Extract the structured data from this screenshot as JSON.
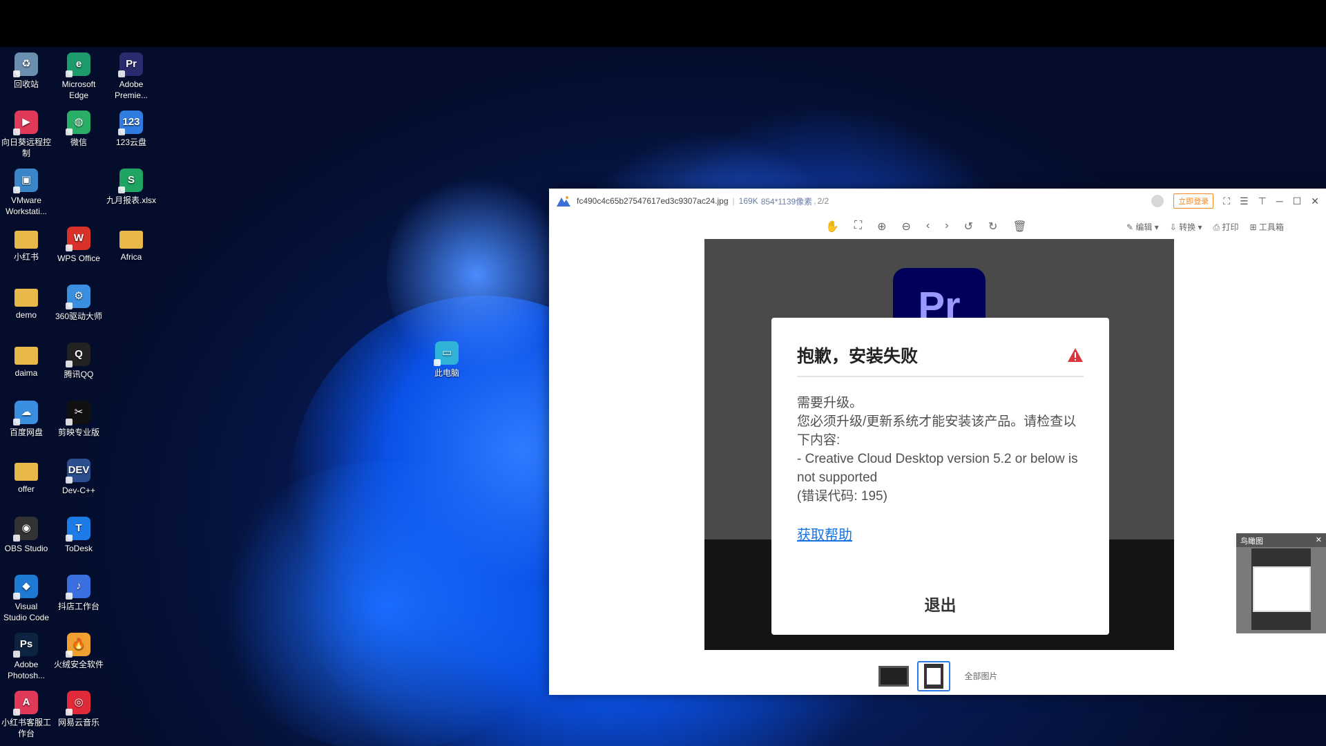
{
  "desktop": {
    "icons": [
      {
        "label": "回收站",
        "glyph": "♻",
        "color": "#6a8fb0"
      },
      {
        "label": "Microsoft\nEdge",
        "glyph": "e",
        "color": "#1d9b6c"
      },
      {
        "label": "Adobe\nPremie...",
        "glyph": "Pr",
        "color": "#2a2a6e"
      },
      {
        "label": "向日葵远程控\n制",
        "glyph": "▶",
        "color": "#e0395a"
      },
      {
        "label": "微信",
        "glyph": "◍",
        "color": "#2aae67"
      },
      {
        "label": "123云盘",
        "glyph": "123",
        "color": "#2f7de1"
      },
      {
        "label": "VMware\nWorkstati...",
        "glyph": "▣",
        "color": "#3a86c8"
      },
      {
        "label": "九月报表.xlsx",
        "glyph": "S",
        "color": "#1fa463"
      },
      {
        "label": "小红书",
        "glyph": "",
        "color": "#e8b84a"
      },
      {
        "label": "WPS Office",
        "glyph": "W",
        "color": "#d9322a"
      },
      {
        "label": "Africa",
        "glyph": "",
        "color": "#e8b84a"
      },
      {
        "label": "demo",
        "glyph": "",
        "color": "#e8b84a"
      },
      {
        "label": "360驱动大师",
        "glyph": "⚙",
        "color": "#3a8fe0"
      },
      {
        "label": "daima",
        "glyph": "",
        "color": "#e8b84a"
      },
      {
        "label": "腾讯QQ",
        "glyph": "Q",
        "color": "#222"
      },
      {
        "label": "百度网盘",
        "glyph": "☁",
        "color": "#3a8fe0"
      },
      {
        "label": "剪映专业版",
        "glyph": "✂",
        "color": "#111"
      },
      {
        "label": "offer",
        "glyph": "",
        "color": "#e8b84a"
      },
      {
        "label": "Dev-C++",
        "glyph": "DEV",
        "color": "#2b4f8e"
      },
      {
        "label": "OBS Studio",
        "glyph": "◉",
        "color": "#333"
      },
      {
        "label": "ToDesk",
        "glyph": "T",
        "color": "#1d7be8"
      },
      {
        "label": "Visual\nStudio Code",
        "glyph": "◆",
        "color": "#1f7ad4"
      },
      {
        "label": "抖店工作台",
        "glyph": "♪",
        "color": "#3a6fe0"
      },
      {
        "label": "Adobe\nPhotosh...",
        "glyph": "Ps",
        "color": "#0c2442"
      },
      {
        "label": "火绒安全软件",
        "glyph": "🔥",
        "color": "#f0a030"
      },
      {
        "label": "小红书客服工\n作台",
        "glyph": "A",
        "color": "#e0395a"
      },
      {
        "label": "网易云音乐",
        "glyph": "◎",
        "color": "#e02a3a"
      },
      {
        "label": "此电脑",
        "glyph": "▭",
        "color": "#2fb3d8"
      }
    ]
  },
  "viewer": {
    "filename": "fc490c4c65b27547617ed3c9307ac24.jpg",
    "filesize": "169K",
    "dimensions": "854*1139像素",
    "page": "2/2",
    "login_label": "立即登录",
    "tools": {
      "edit": "编辑",
      "convert": "转换",
      "print": "打印",
      "toolbox": "工具箱"
    },
    "all_pictures": "全部图片",
    "navigator_title": "鸟瞰图"
  },
  "dialog": {
    "title": "抱歉，安装失败",
    "body_lines": {
      "l1": "需要升级。",
      "l2": "您必须升级/更新系统才能安装该产品。请检查以下内容:",
      "l3": "- Creative Cloud Desktop version 5.2 or below is not supported",
      "l4": "(错误代码: 195)"
    },
    "help_link": "获取帮助",
    "exit_label": "退出",
    "logo_text": "Pr"
  }
}
